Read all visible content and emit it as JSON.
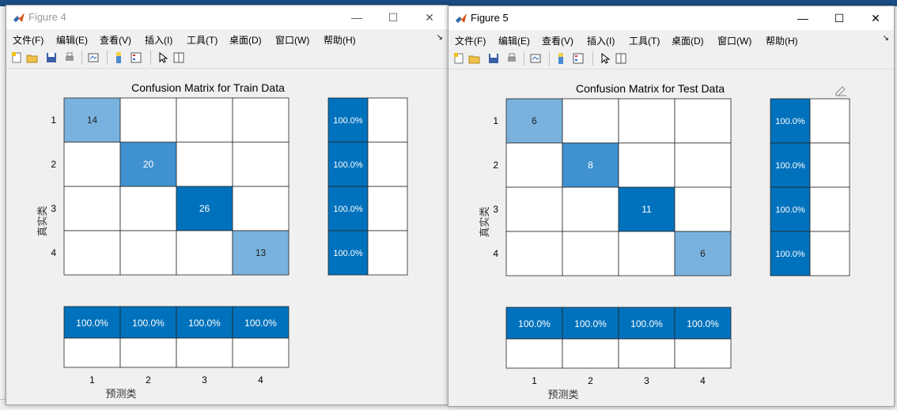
{
  "menu": [
    "文件(F)",
    "编辑(E)",
    "查看(V)",
    "插入(I)",
    "工具(T)",
    "桌面(D)",
    "窗口(W)",
    "帮助(H)"
  ],
  "window_controls": {
    "minimize": "—",
    "maximize": "☐",
    "close": "✕"
  },
  "toolbar_icons": [
    "new-figure-icon",
    "open-file-icon",
    "save-icon",
    "print-icon",
    "link-plot-icon",
    "insert-colorbar-icon",
    "insert-legend-icon",
    "edit-plot-icon",
    "property-inspector-icon"
  ],
  "colors": {
    "dark": "#0072bd",
    "medium": "#3f91cf",
    "light": "#79b2de",
    "grid": "#262626"
  },
  "figures": [
    {
      "title": "Figure 4",
      "active": false,
      "chart_data": {
        "type": "heatmap",
        "title": "Confusion Matrix for Train Data",
        "xlabel": "预测类",
        "ylabel": "真实类",
        "classes": [
          "1",
          "2",
          "3",
          "4"
        ],
        "matrix": [
          [
            14,
            0,
            0,
            0
          ],
          [
            0,
            20,
            0,
            0
          ],
          [
            0,
            0,
            26,
            0
          ],
          [
            0,
            0,
            0,
            13
          ]
        ],
        "row_summary": [
          "100.0%",
          "100.0%",
          "100.0%",
          "100.0%"
        ],
        "column_summary": [
          "100.0%",
          "100.0%",
          "100.0%",
          "100.0%"
        ]
      }
    },
    {
      "title": "Figure 5",
      "active": true,
      "chart_data": {
        "type": "heatmap",
        "title": "Confusion Matrix for Test Data",
        "xlabel": "预测类",
        "ylabel": "真实类",
        "classes": [
          "1",
          "2",
          "3",
          "4"
        ],
        "matrix": [
          [
            6,
            0,
            0,
            0
          ],
          [
            0,
            8,
            0,
            0
          ],
          [
            0,
            0,
            11,
            0
          ],
          [
            0,
            0,
            0,
            6
          ]
        ],
        "row_summary": [
          "100.0%",
          "100.0%",
          "100.0%",
          "100.0%"
        ],
        "column_summary": [
          "100.0%",
          "100.0%",
          "100.0%",
          "100.0%"
        ]
      }
    }
  ]
}
